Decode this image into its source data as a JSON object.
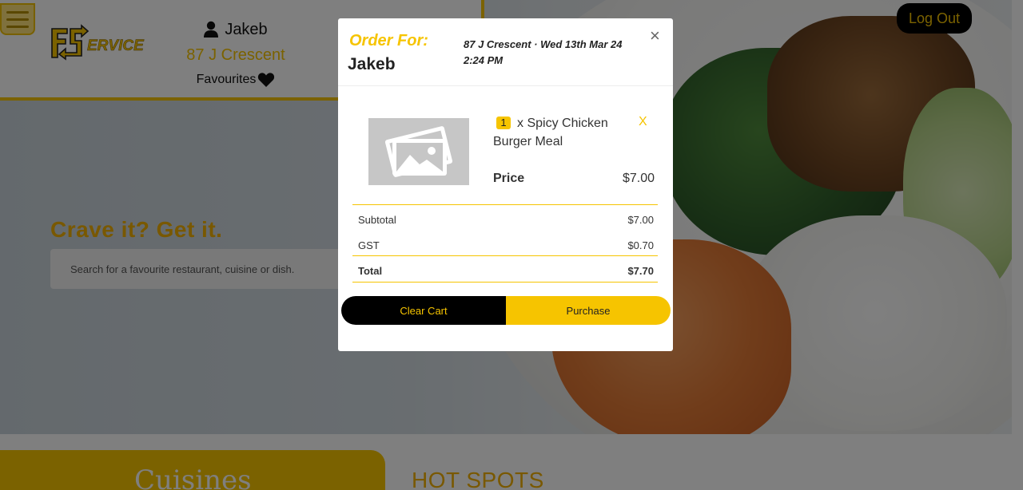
{
  "header": {
    "user_name": "Jakeb",
    "address": "87 J Crescent",
    "favourites_label": "Favourites",
    "logout_label": "Log Out"
  },
  "hero": {
    "tagline": "Crave it? Get it.",
    "search_placeholder": "Search for a favourite restaurant, cuisine or dish."
  },
  "sections": {
    "cuisines_title": "Cuisines",
    "hotspots_title": "HOT SPOTS"
  },
  "modal": {
    "order_for_label": "Order For:",
    "order_name": "Jakeb",
    "order_meta_line1": "87 J Crescent · Wed 13th Mar 24",
    "order_meta_line2": "2:24 PM",
    "close_label": "×",
    "item": {
      "quantity": "1",
      "name": "x Spicy Chicken Burger Meal",
      "remove_label": "X",
      "price_label": "Price",
      "price": "$7.00"
    },
    "summary": {
      "subtotal_label": "Subtotal",
      "subtotal": "$7.00",
      "gst_label": "GST",
      "gst": "$0.70",
      "total_label": "Total",
      "total": "$7.70"
    },
    "clear_label": "Clear Cart",
    "purchase_label": "Purchase"
  },
  "colors": {
    "accent": "#f6c400",
    "dark": "#000000"
  }
}
